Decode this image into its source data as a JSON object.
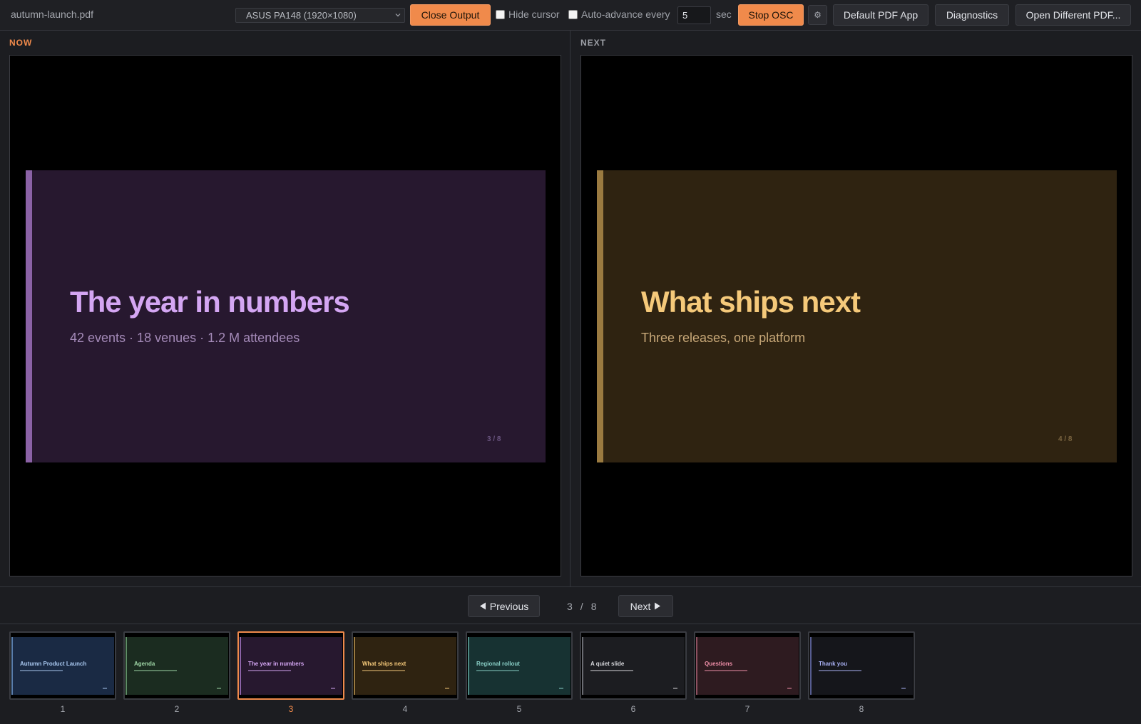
{
  "app": {
    "filename": "autumn-launch.pdf"
  },
  "toolbar": {
    "display_select": "ASUS PA148 (1920×1080)",
    "close_output": "Close Output",
    "hide_cursor_label": "Hide cursor",
    "hide_cursor_checked": false,
    "auto_advance_label": "Auto-advance every",
    "auto_advance_checked": false,
    "auto_advance_seconds": "5",
    "seconds_unit": "sec",
    "stop_osc": "Stop OSC",
    "settings_icon": "⚙",
    "default_pdf_app": "Default PDF App",
    "diagnostics": "Diagnostics",
    "open_different": "Open Different PDF..."
  },
  "now": {
    "label": "NOW",
    "slide": {
      "title": "The year in numbers",
      "subtitle": "42 events · 18 venues · 1.2 M attendees",
      "page": "3 / 8"
    }
  },
  "next": {
    "label": "NEXT",
    "slide": {
      "title": "What ships next",
      "subtitle": "Three releases, one platform",
      "page": "4 / 8"
    }
  },
  "nav": {
    "previous": "Previous",
    "next": "Next",
    "current": "3",
    "separator": "/",
    "total": "8"
  },
  "thumbnails": [
    {
      "number": "1",
      "title": "Autumn Product Launch",
      "bg": "#1a2a44",
      "fg": "#a9c8f0",
      "bar": "#5b7fae"
    },
    {
      "number": "2",
      "title": "Agenda",
      "bg": "#1b2c20",
      "fg": "#9fd6a6",
      "bar": "#5e8c66"
    },
    {
      "number": "3",
      "title": "The year in numbers",
      "bg": "#27182f",
      "fg": "#d4a6f3",
      "bar": "#8b62a6",
      "active": true
    },
    {
      "number": "4",
      "title": "What ships next",
      "bg": "#2f2311",
      "fg": "#f5c97a",
      "bar": "#9a7a40"
    },
    {
      "number": "5",
      "title": "Regional rollout",
      "bg": "#173232",
      "fg": "#8ad0c7",
      "bar": "#4f8a84"
    },
    {
      "number": "6",
      "title": "A quiet slide",
      "bg": "#1c1d21",
      "fg": "#d7d8dc",
      "bar": "#6a6c72"
    },
    {
      "number": "7",
      "title": "Questions",
      "bg": "#2e1b20",
      "fg": "#ef8fa8",
      "bar": "#8c5060"
    },
    {
      "number": "8",
      "title": "Thank you",
      "bg": "#15161b",
      "fg": "#aab2f5",
      "bar": "#565c90"
    }
  ],
  "colors": {
    "accent": "#f08a4b",
    "now_slide_bg": "#27182f",
    "now_slide_bar": "#8b62a6",
    "now_slide_title": "#d4a6f3",
    "now_slide_sub": "#a48ab8",
    "now_slide_pg": "#6a5580",
    "next_slide_bg": "#2f2311",
    "next_slide_bar": "#9a7a40",
    "next_slide_title": "#f5c97a",
    "next_slide_sub": "#c8a878",
    "next_slide_pg": "#7a6440"
  }
}
